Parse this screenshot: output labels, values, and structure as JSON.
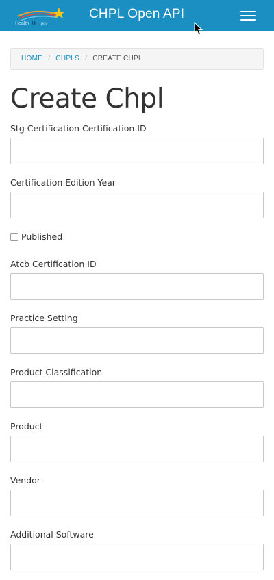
{
  "header": {
    "title": "CHPL Open API",
    "logo_icon": "healthit-logo-icon",
    "menu_icon": "hamburger-menu-icon",
    "brand_color": "#1b8fc2"
  },
  "breadcrumb": {
    "home": "HOME",
    "chpls": "CHPLS",
    "current": "CREATE CHPL",
    "separator": "/"
  },
  "page": {
    "title": "Create Chpl"
  },
  "form": {
    "stg_certification_id": {
      "label": "Stg Certification Certification ID",
      "value": ""
    },
    "certification_edition_year": {
      "label": "Certification Edition Year",
      "value": ""
    },
    "published": {
      "label": "Published",
      "checked": false
    },
    "atcb_certification_id": {
      "label": "Atcb Certification ID",
      "value": ""
    },
    "practice_setting": {
      "label": "Practice Setting",
      "value": ""
    },
    "product_classification": {
      "label": "Product Classification",
      "value": ""
    },
    "product": {
      "label": "Product",
      "value": ""
    },
    "vendor": {
      "label": "Vendor",
      "value": ""
    },
    "additional_software": {
      "label": "Additional Software",
      "value": ""
    }
  }
}
